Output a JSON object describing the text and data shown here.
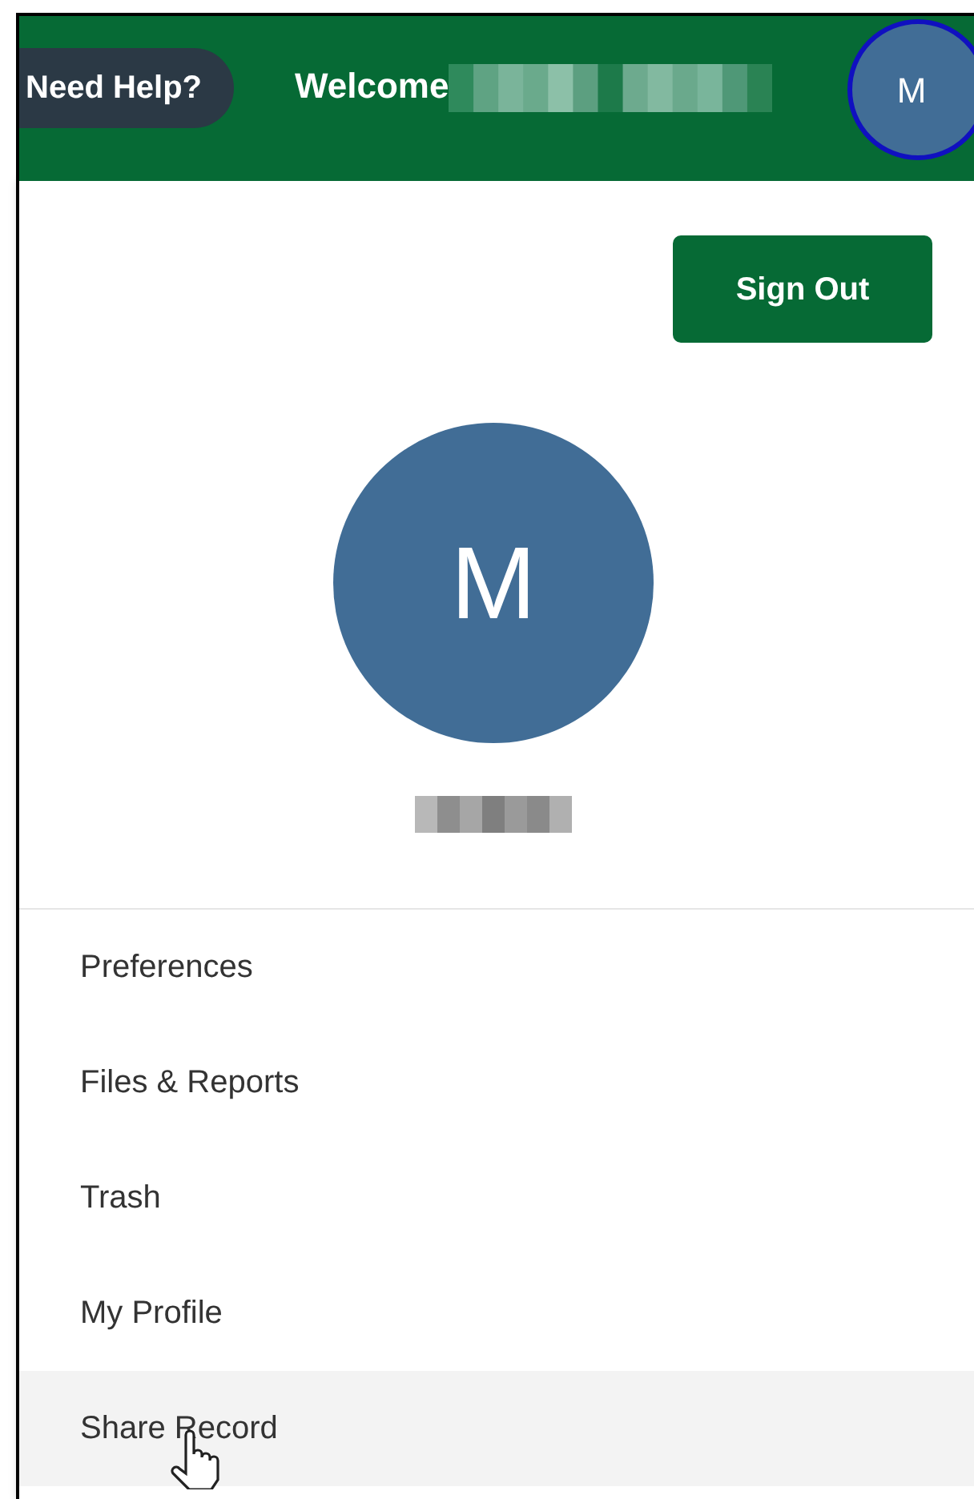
{
  "header": {
    "help_button": "Need Help?",
    "welcome": "Welcome",
    "avatar_initial": "M"
  },
  "profile_menu": {
    "sign_out_button": "Sign Out",
    "avatar_initial": "M",
    "items": [
      {
        "label": "Preferences",
        "selected": false
      },
      {
        "label": "Files & Reports",
        "selected": false
      },
      {
        "label": "Trash",
        "selected": false
      },
      {
        "label": "My Profile",
        "selected": false
      },
      {
        "label": "Share Record",
        "selected": true
      }
    ]
  }
}
